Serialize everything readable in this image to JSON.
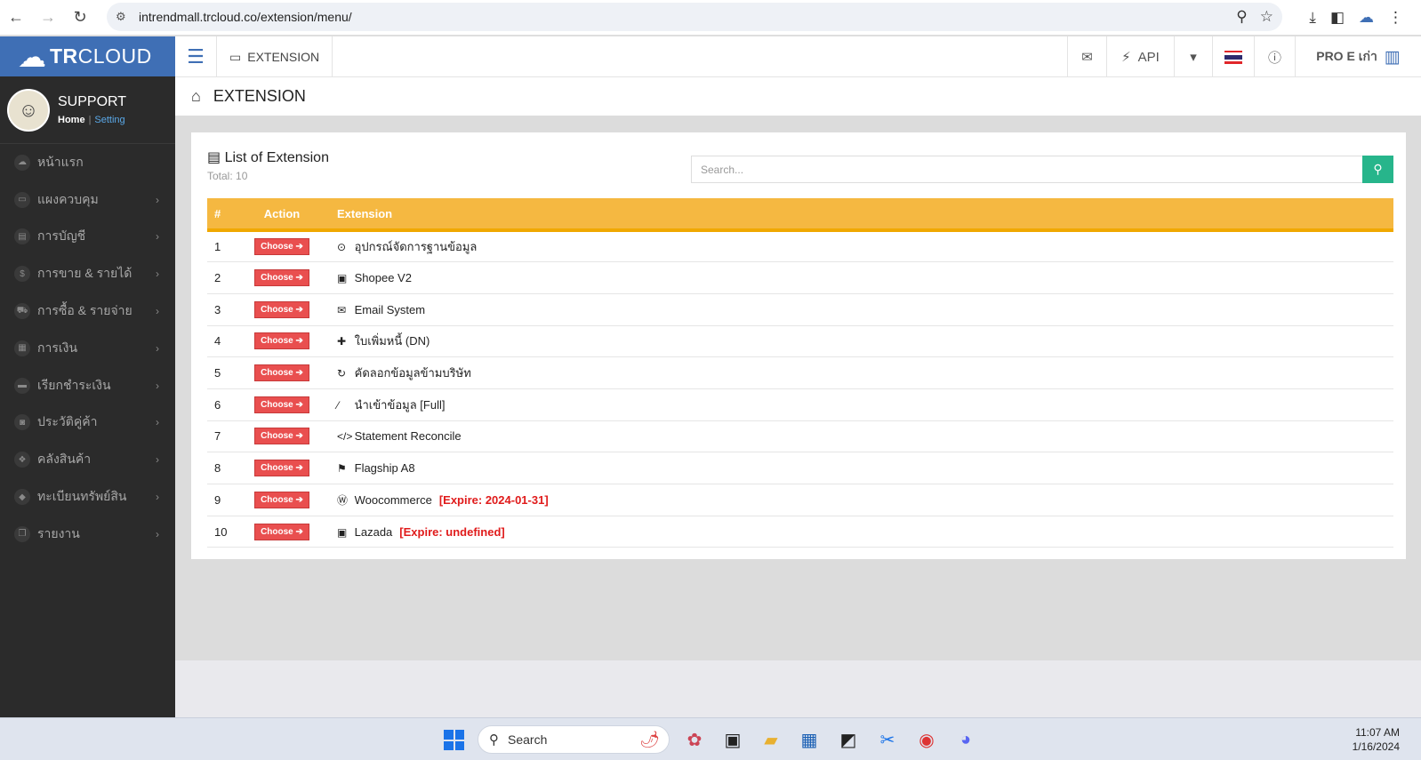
{
  "browser": {
    "url": "intrendmall.trcloud.co/extension/menu/"
  },
  "sidebar": {
    "brand_bold": "TR",
    "brand_rest": "CLOUD",
    "user": "SUPPORT",
    "home_link": "Home",
    "setting_link": "Setting",
    "items": [
      {
        "label": "หน้าแรก",
        "icon": "cloud-icon",
        "glyph": "☁",
        "has_children": false
      },
      {
        "label": "แผงควบคุม",
        "icon": "desktop-icon",
        "glyph": "▭",
        "has_children": true
      },
      {
        "label": "การบัญชี",
        "icon": "book-icon",
        "glyph": "▤",
        "has_children": true
      },
      {
        "label": "การขาย & รายได้",
        "icon": "dollar-icon",
        "glyph": "$",
        "has_children": true
      },
      {
        "label": "การซื้อ & รายจ่าย",
        "icon": "cart-icon",
        "glyph": "⛟",
        "has_children": true
      },
      {
        "label": "การเงิน",
        "icon": "calendar-icon",
        "glyph": "▦",
        "has_children": true
      },
      {
        "label": "เรียกชำระเงิน",
        "icon": "credit-card-icon",
        "glyph": "▬",
        "has_children": true
      },
      {
        "label": "ประวัติคู่ค้า",
        "icon": "address-book-icon",
        "glyph": "◙",
        "has_children": true
      },
      {
        "label": "คลังสินค้า",
        "icon": "cubes-icon",
        "glyph": "❖",
        "has_children": true
      },
      {
        "label": "ทะเบียนทรัพย์สิน",
        "icon": "diamond-icon",
        "glyph": "◆",
        "has_children": true
      },
      {
        "label": "รายงาน",
        "icon": "copy-icon",
        "glyph": "❐",
        "has_children": true
      }
    ]
  },
  "header": {
    "tab_label": "EXTENSION",
    "api_label": "API",
    "plan_label": "PRO E เก่า"
  },
  "page": {
    "title": "EXTENSION"
  },
  "panel": {
    "title": "List of Extension",
    "total": "Total: 10",
    "search_placeholder": "Search..."
  },
  "table": {
    "headers": {
      "num": "#",
      "action": "Action",
      "extension": "Extension"
    },
    "choose_label": "Choose ➔",
    "rows": [
      {
        "num": "1",
        "name": "อุปกรณ์จัดการฐานข้อมูล",
        "icon": "gamepad-icon",
        "glyph": "⊙",
        "expire": ""
      },
      {
        "num": "2",
        "name": "Shopee V2",
        "icon": "shopping-bag-icon",
        "glyph": "▣",
        "expire": ""
      },
      {
        "num": "3",
        "name": "Email System",
        "icon": "envelope-icon",
        "glyph": "✉",
        "expire": ""
      },
      {
        "num": "4",
        "name": "ใบเพิ่มหนี้ (DN)",
        "icon": "plus-icon",
        "glyph": "✚",
        "expire": ""
      },
      {
        "num": "5",
        "name": "คัดลอกข้อมูลข้ามบริษัท",
        "icon": "refresh-icon",
        "glyph": "↻",
        "expire": ""
      },
      {
        "num": "6",
        "name": "นำเข้าข้อมูล [Full]",
        "icon": "magic-wand-icon",
        "glyph": "⁄",
        "expire": ""
      },
      {
        "num": "7",
        "name": "Statement Reconcile",
        "icon": "code-icon",
        "glyph": "</>",
        "expire": ""
      },
      {
        "num": "8",
        "name": "Flagship A8",
        "icon": "flag-icon",
        "glyph": "⚑",
        "expire": ""
      },
      {
        "num": "9",
        "name": "Woocommerce",
        "icon": "wordpress-icon",
        "glyph": "Ⓦ",
        "expire": "[Expire: 2024-01-31]"
      },
      {
        "num": "10",
        "name": "Lazada",
        "icon": "shopping-bag-icon",
        "glyph": "▣",
        "expire": "[Expire: undefined]"
      }
    ]
  },
  "taskbar": {
    "search_label": "Search",
    "time": "11:07 AM",
    "date": "1/16/2024"
  },
  "colors": {
    "brand": "#3f6fb5",
    "sidebar": "#2b2b2b",
    "table_header": "#f5b841",
    "choose_button": "#e94f4f",
    "search_button": "#27b58b",
    "expire_text": "#e01b1b"
  }
}
